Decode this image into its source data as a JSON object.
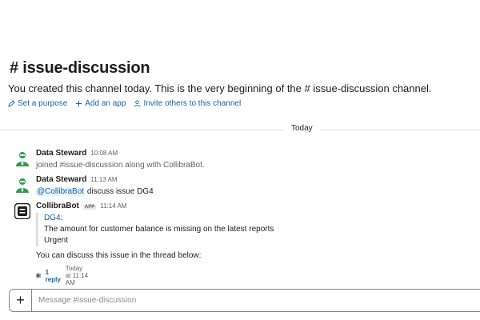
{
  "channel": {
    "title": "# issue-discussion",
    "intro_prefix": "You created this channel today. This is the very beginning of the ",
    "intro_channel": "# issue-discussion",
    "intro_suffix": " channel."
  },
  "actions": [
    {
      "label": "Set a purpose",
      "icon": "pencil-icon"
    },
    {
      "label": "Add an app",
      "icon": "plus-icon"
    },
    {
      "label": "Invite others to this channel",
      "icon": "person-icon"
    }
  ],
  "day_divider": "Today",
  "messages": [
    {
      "author": "Data Steward",
      "time": "10:08 AM",
      "text": "joined #issue-discussion along with CollibraBot."
    },
    {
      "author": "Data Steward",
      "time": "11:13 AM",
      "mention": "@CollibraBot",
      "text": " discuss issue DG4"
    },
    {
      "author": "CollibraBot",
      "badge": "APP",
      "time": "11:14 AM",
      "quote_link": "DG4",
      "quote_colon": ":",
      "quote_line2": "The amount for customer balance is missing on the latest reports",
      "quote_line3": "Urgent",
      "followup": "You can discuss this issue in the thread below:",
      "thread": {
        "replies": "1 reply",
        "meta": "Today at 11:14 AM"
      }
    }
  ],
  "composer": {
    "placeholder": "Message #issue-discussion",
    "add_label": "+"
  },
  "colors": {
    "link": "#1264a3",
    "avatar_green": "#2e9b4a",
    "bot_dark": "#1d1c1d"
  }
}
